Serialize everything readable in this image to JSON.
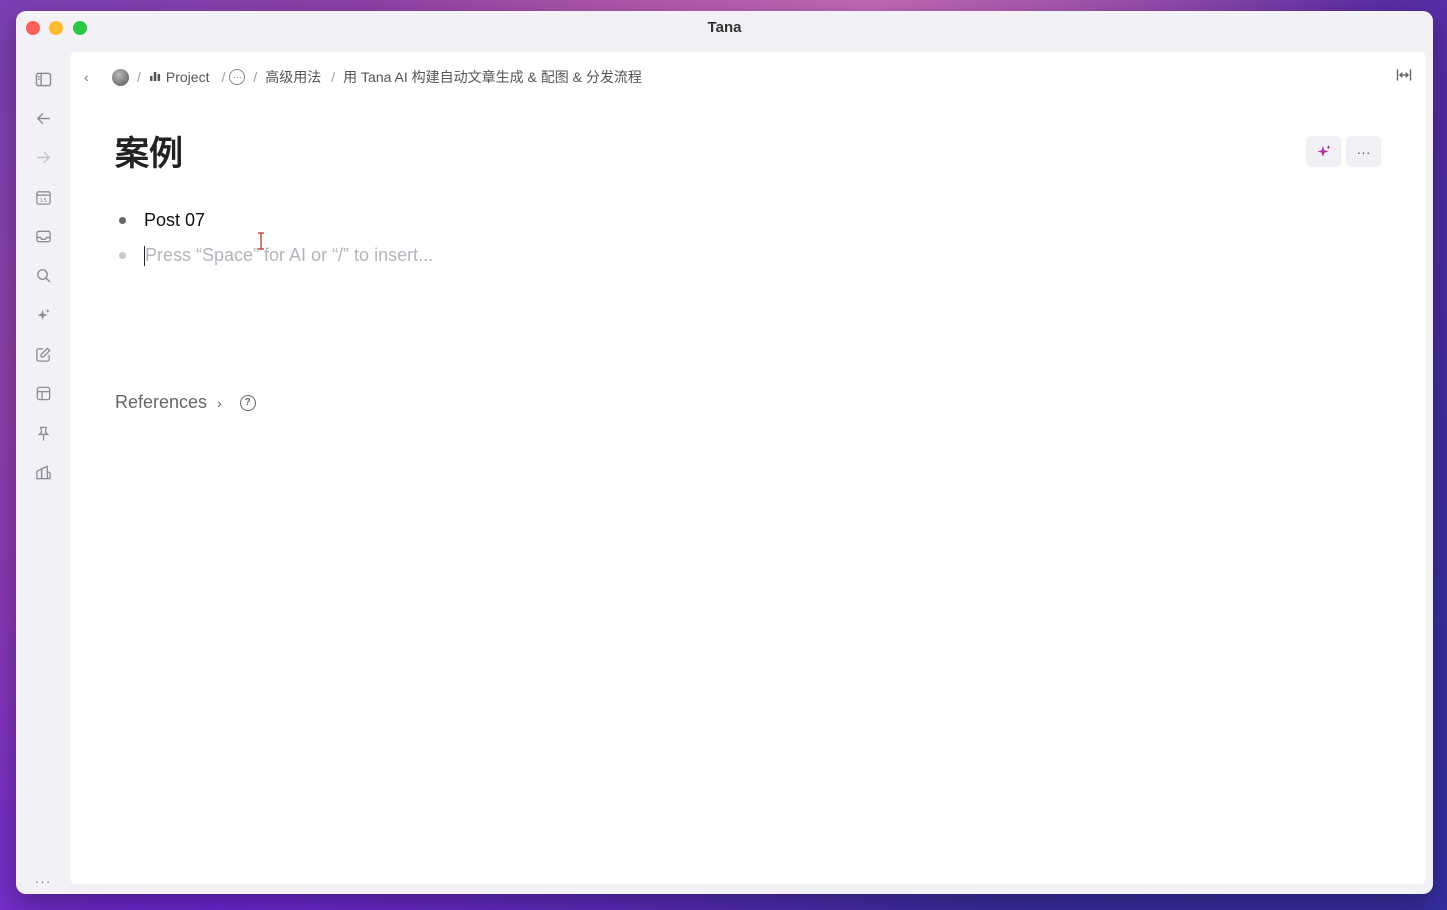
{
  "window": {
    "title": "Tana"
  },
  "sidebar": {
    "items": [
      {
        "icon": "sidebar-toggle-icon"
      },
      {
        "icon": "back-arrow-icon"
      },
      {
        "icon": "forward-arrow-icon"
      },
      {
        "icon": "calendar-icon",
        "label": "15"
      },
      {
        "icon": "inbox-icon"
      },
      {
        "icon": "search-icon"
      },
      {
        "icon": "ai-sparkle-icon"
      },
      {
        "icon": "edit-icon"
      },
      {
        "icon": "layout-icon"
      },
      {
        "icon": "pin-icon"
      },
      {
        "icon": "workspace-icon"
      },
      {
        "icon": "more-icon",
        "label": "···"
      }
    ]
  },
  "breadcrumb": {
    "back": "‹",
    "sep": "/",
    "project": "Project",
    "more": "···",
    "section": "高级用法",
    "page": "用 Tana AI 构建自动文章生成 & 配图 & 分发流程"
  },
  "page": {
    "title": "案例",
    "nodes": [
      {
        "text": "Post 07"
      }
    ],
    "placeholder": "Press “Space” for AI or “/” to insert...",
    "references_label": "References",
    "more_label": "···"
  }
}
